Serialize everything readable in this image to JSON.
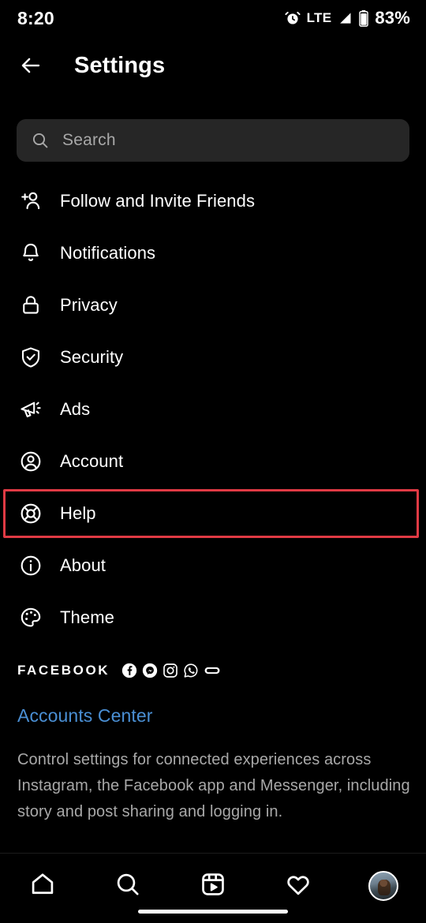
{
  "status_bar": {
    "time": "8:20",
    "alarm_icon": "alarm-clock-icon",
    "network": "LTE",
    "signal_icon": "signal-bars-icon",
    "battery_icon": "battery-icon",
    "battery_percent": "83%"
  },
  "header": {
    "back_icon": "back-arrow-icon",
    "title": "Settings"
  },
  "search": {
    "icon": "search-icon",
    "placeholder": "Search",
    "value": ""
  },
  "menu": {
    "items": [
      {
        "label": "Follow and Invite Friends",
        "icon": "person-plus-icon",
        "highlighted": false
      },
      {
        "label": "Notifications",
        "icon": "bell-icon",
        "highlighted": false
      },
      {
        "label": "Privacy",
        "icon": "lock-icon",
        "highlighted": false
      },
      {
        "label": "Security",
        "icon": "shield-check-icon",
        "highlighted": false
      },
      {
        "label": "Ads",
        "icon": "megaphone-icon",
        "highlighted": false
      },
      {
        "label": "Account",
        "icon": "account-circle-icon",
        "highlighted": false
      },
      {
        "label": "Help",
        "icon": "lifebuoy-icon",
        "highlighted": true
      },
      {
        "label": "About",
        "icon": "info-circle-icon",
        "highlighted": false
      },
      {
        "label": "Theme",
        "icon": "palette-icon",
        "highlighted": false
      }
    ]
  },
  "facebook_section": {
    "title": "FACEBOOK",
    "brand_icons": [
      "facebook-icon",
      "messenger-icon",
      "instagram-icon",
      "whatsapp-icon",
      "portal-icon"
    ],
    "accounts_center_link": "Accounts Center",
    "description": "Control settings for connected experiences across Instagram, the Facebook app and Messenger, including story and post sharing and logging in."
  },
  "bottom_nav": {
    "items": [
      {
        "icon": "home-icon",
        "label": "Home"
      },
      {
        "icon": "search-icon",
        "label": "Search"
      },
      {
        "icon": "reels-icon",
        "label": "Reels"
      },
      {
        "icon": "heart-icon",
        "label": "Activity"
      },
      {
        "icon": "profile-avatar",
        "label": "Profile"
      }
    ]
  },
  "colors": {
    "background": "#000000",
    "text_primary": "#ffffff",
    "text_secondary": "#a8a8a8",
    "search_field": "#262626",
    "link_blue": "#4a8fd4",
    "highlight_red": "#e03a44"
  }
}
